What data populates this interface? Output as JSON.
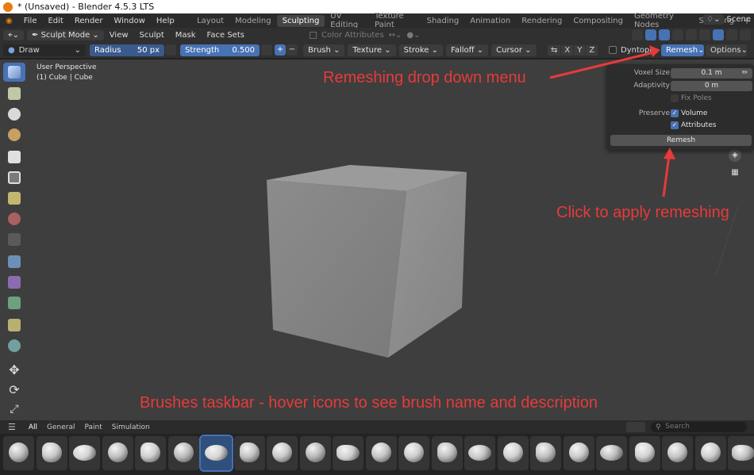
{
  "window": {
    "title": "* (Unsaved) - Blender 4.5.3 LTS"
  },
  "menu": {
    "items": [
      "File",
      "Edit",
      "Render",
      "Window",
      "Help"
    ]
  },
  "workspaces": {
    "tabs": [
      "Layout",
      "Modeling",
      "Sculpting",
      "UV Editing",
      "Texture Paint",
      "Shading",
      "Animation",
      "Rendering",
      "Compositing",
      "Geometry Nodes",
      "Scripting"
    ],
    "active": "Sculpting",
    "add": "+"
  },
  "scene": {
    "label": "Scene"
  },
  "header": {
    "mode": "Sculpt Mode",
    "menus": [
      "View",
      "Sculpt",
      "Mask",
      "Face Sets"
    ],
    "color_attributes": "Color Attributes"
  },
  "toolheader": {
    "brush": "Draw",
    "radius_label": "Radius",
    "radius_value": "50 px",
    "strength_label": "Strength",
    "strength_value": "0.500",
    "plus": "+",
    "minus": "−",
    "menus": [
      "Brush",
      "Texture",
      "Stroke",
      "Falloff",
      "Cursor"
    ],
    "axes": [
      "X",
      "Y",
      "Z"
    ],
    "dyntopo": "Dyntopo",
    "remesh": "Remesh",
    "options": "Options"
  },
  "viewport": {
    "title": "User Perspective",
    "subtitle": "(1) Cube | Cube"
  },
  "remesh_popover": {
    "voxel_size_label": "Voxel Size",
    "voxel_size": "0.1 m",
    "adaptivity_label": "Adaptivity",
    "adaptivity": "0 m",
    "fix_poles": "Fix Poles",
    "fix_poles_checked": false,
    "preserve_label": "Preserve",
    "volume": "Volume",
    "volume_checked": true,
    "attributes": "Attributes",
    "attributes_checked": true,
    "button": "Remesh"
  },
  "annotations": {
    "remesh_menu": "Remeshing drop down menu",
    "apply": "Click to apply remeshing",
    "brushes": "Brushes taskbar - hover icons to see brush name and description"
  },
  "shelf": {
    "tabs": [
      "All",
      "General",
      "Paint",
      "Simulation"
    ],
    "active_tab": "All",
    "search_placeholder": "Search"
  },
  "colors": {
    "accent": "#4772b3",
    "annotation": "#e83a3a",
    "viewport_bg": "#3e3e3e"
  }
}
